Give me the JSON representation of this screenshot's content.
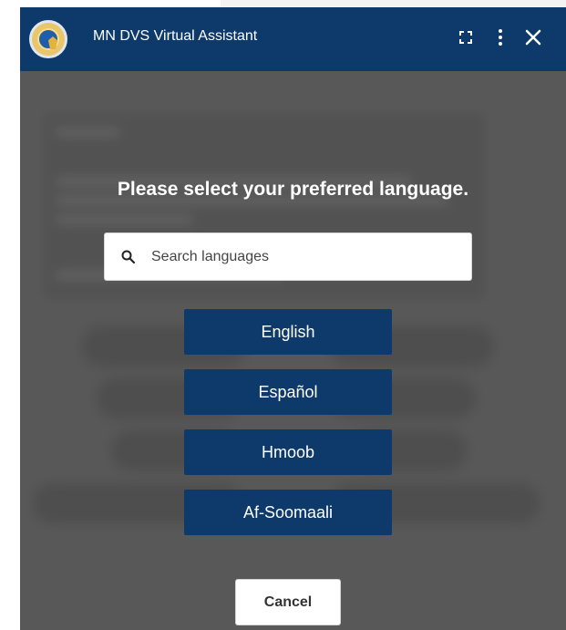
{
  "window": {
    "title": "MN DVS Virtual Assistant"
  },
  "header": {
    "logo_icon": "state-seal-icon",
    "expand_icon": "expand-icon",
    "menu_icon": "more-vertical-icon",
    "close_icon": "close-icon",
    "accent": "#0d3a6b"
  },
  "modal": {
    "prompt": "Please select your preferred language.",
    "search": {
      "placeholder": "Search languages",
      "icon": "search-icon"
    },
    "languages": [
      "English",
      "Español",
      "Hmoob",
      "Af-Soomaali"
    ],
    "cancel_label": "Cancel"
  }
}
